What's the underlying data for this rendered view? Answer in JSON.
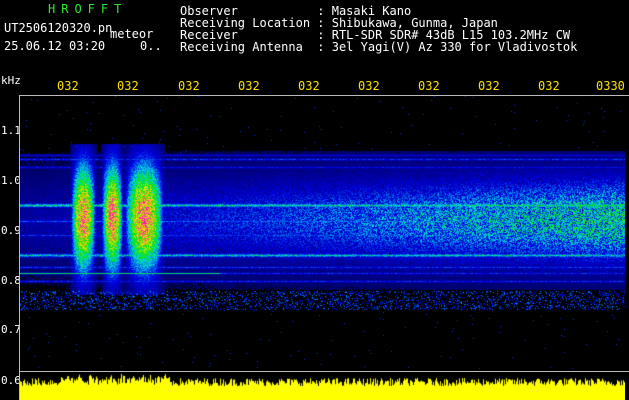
{
  "header": {
    "app_title": "HROFFT",
    "file_name": "UT2506120320.pn",
    "file_sub": "meteor",
    "date_time": "25.06.12 03:20",
    "date_extra": "0..",
    "info": [
      {
        "label": "Observer          ",
        "value": ": Masaki Kano"
      },
      {
        "label": "Receiving Location",
        "value": ": Shibukawa, Gunma, Japan"
      },
      {
        "label": "Receiver          ",
        "value": ": RTL-SDR SDR# 43dB L15 103.2MHz CW"
      },
      {
        "label": "Receiving Antenna ",
        "value": ": 3el Yagi(V) Az 330 for Vladivostok"
      }
    ]
  },
  "axis": {
    "x_ticks": [
      "032",
      "032",
      "032",
      "032",
      "032",
      "032",
      "032",
      "032",
      "032",
      "0330"
    ],
    "y_unit": "kHz",
    "y_ticks": [
      "1.1",
      "1.0",
      "0.9",
      "0.8",
      "0.7",
      "0.6"
    ]
  },
  "colors": {
    "title": "#2ee82e",
    "tick": "#ffe000",
    "amplitude": "#ffff00"
  }
}
